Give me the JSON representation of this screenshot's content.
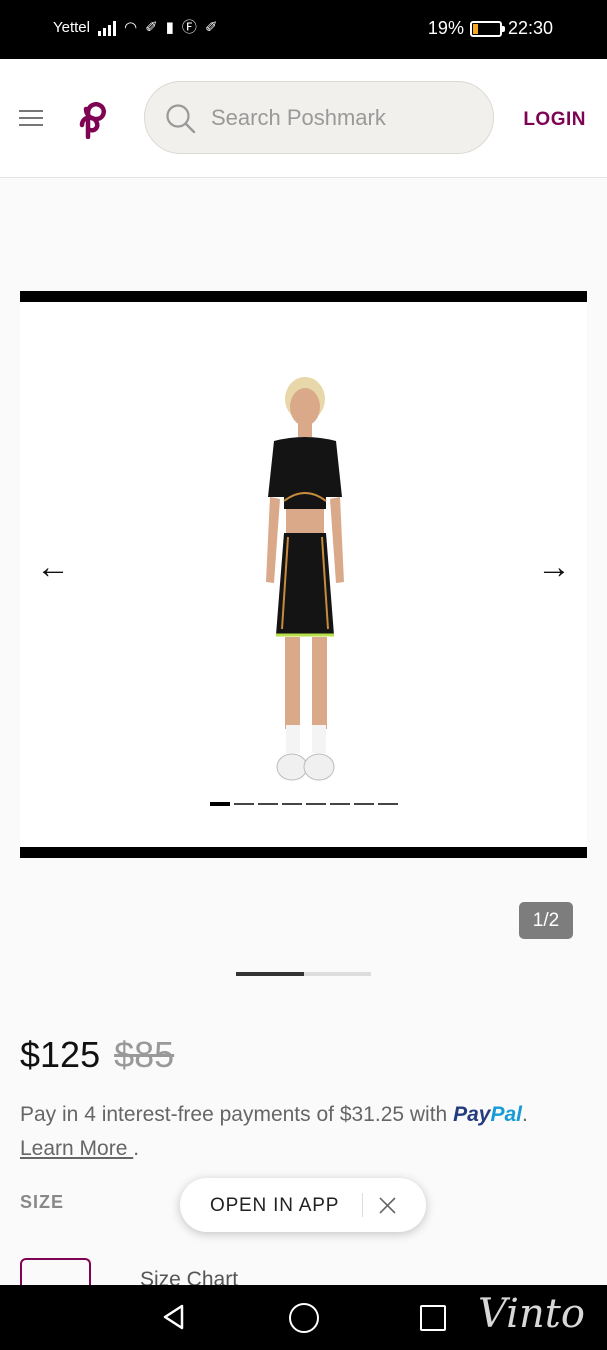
{
  "status_bar": {
    "carrier": "Yettel",
    "battery_percent": "19%",
    "battery_level": 0.19,
    "time": "22:30",
    "icons": [
      "signal-icon",
      "wifi-icon",
      "notification-icon",
      "notification-icon",
      "alert-icon",
      "facebook-icon",
      "notification-icon"
    ]
  },
  "header": {
    "search_placeholder": "Search Poshmark",
    "login_label": "LOGIN",
    "brand_color": "#7f0353"
  },
  "carousel": {
    "prev_arrow": "←",
    "next_arrow": "→",
    "dot_count": 8,
    "active_dot": 1,
    "counter": "1/2",
    "page_progress": 0.5
  },
  "product": {
    "price": "$125",
    "original_price": "$85",
    "paypal_text": "Pay in 4 interest-free payments of $31.25 with",
    "paypal_brand_1": "Pay",
    "paypal_brand_2": "Pal",
    "learn_more": "Learn More ",
    "period": ".",
    "size_label": "SIZE",
    "size_chart": "Size Chart"
  },
  "open_app": {
    "label": "OPEN IN APP"
  },
  "watermark": "Vinto"
}
